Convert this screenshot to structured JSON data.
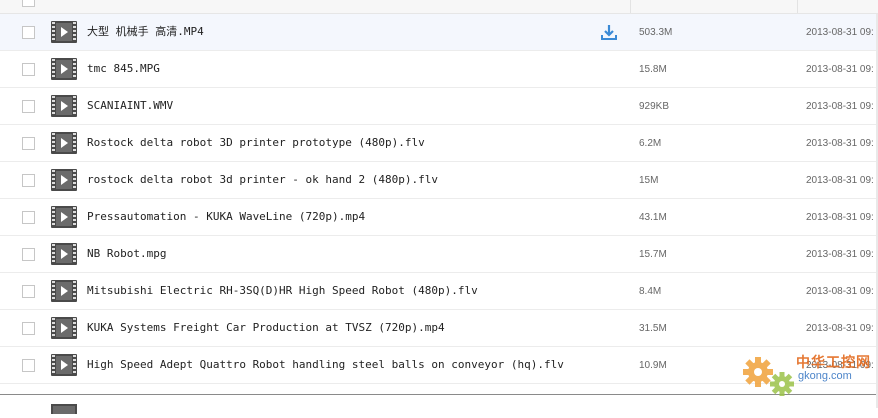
{
  "files": [
    {
      "name": "大型 机械手 高清.MP4",
      "size": "503.3M",
      "date": "2013-08-31 09:",
      "selected": true
    },
    {
      "name": "tmc 845.MPG",
      "size": "15.8M",
      "date": "2013-08-31 09:"
    },
    {
      "name": "SCANIAINT.WMV",
      "size": "929KB",
      "date": "2013-08-31 09:"
    },
    {
      "name": "Rostock delta robot 3D printer prototype (480p).flv",
      "size": "6.2M",
      "date": "2013-08-31 09:"
    },
    {
      "name": "rostock delta robot 3d printer - ok hand 2 (480p).flv",
      "size": "15M",
      "date": "2013-08-31 09:"
    },
    {
      "name": "Pressautomation - KUKA WaveLine (720p).mp4",
      "size": "43.1M",
      "date": "2013-08-31 09:"
    },
    {
      "name": "NB Robot.mpg",
      "size": "15.7M",
      "date": "2013-08-31 09:"
    },
    {
      "name": "Mitsubishi Electric RH-3SQ(D)HR High Speed Robot (480p).flv",
      "size": "8.4M",
      "date": "2013-08-31 09:"
    },
    {
      "name": "KUKA Systems Freight Car Production at TVSZ (720p).mp4",
      "size": "31.5M",
      "date": "2013-08-31 09:"
    },
    {
      "name": "High Speed Adept Quattro Robot handling steel balls on conveyor (hq).flv",
      "size": "10.9M",
      "date": "2013-08-31 09:"
    }
  ],
  "watermark": {
    "title": "中华工控网",
    "domain": "gkong.com"
  },
  "icons": {
    "file": "video-file-icon",
    "download": "download-icon",
    "watermark": "gear-logo-icon"
  },
  "colors": {
    "accent": "#3a8ad6",
    "selected_row": "#f4f7fd",
    "watermark_orange": "#e36a1e"
  }
}
